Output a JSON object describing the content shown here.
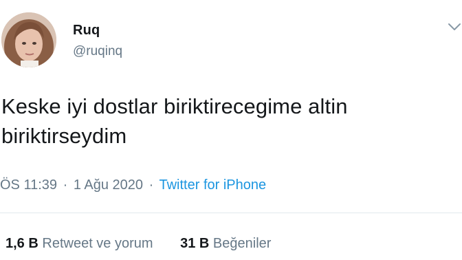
{
  "user": {
    "display_name": "Ruq",
    "handle": "@ruqinq"
  },
  "tweet": {
    "text_line1": "Keske iyi dostlar biriktirecegime altin",
    "text_line2": "biriktirseydim"
  },
  "meta": {
    "time": "ÖS 11:39",
    "separator": "·",
    "date": "1 Ağu 2020",
    "source": "Twitter for iPhone"
  },
  "stats": {
    "retweets_count": "1,6 B",
    "retweets_label": "Retweet ve yorum",
    "likes_count": "31 B",
    "likes_label": "Beğeniler"
  },
  "colors": {
    "text": "#14171a",
    "secondary": "#657786",
    "link": "#1b95e0",
    "divider": "#e1e8ed"
  },
  "icons": {
    "caret": "chevron-down-icon"
  }
}
